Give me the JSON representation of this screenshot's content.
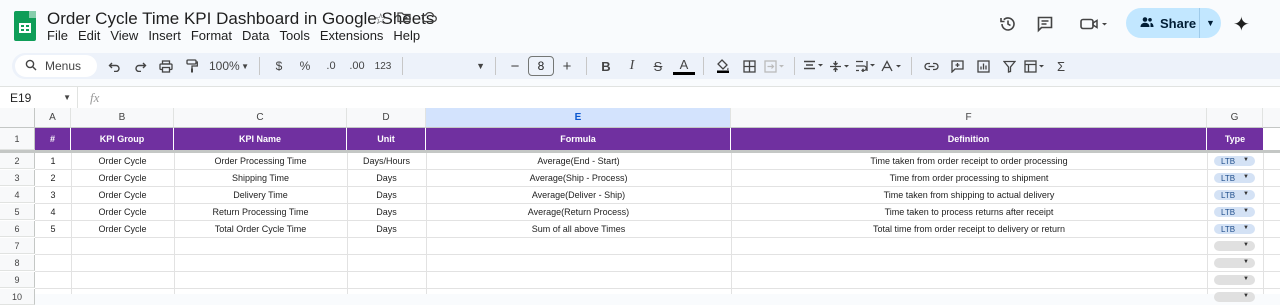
{
  "app": {
    "doc_title": "Order Cycle Time KPI Dashboard in Google Sheets",
    "menu": [
      "File",
      "Edit",
      "View",
      "Insert",
      "Format",
      "Data",
      "Tools",
      "Extensions",
      "Help"
    ],
    "share_label": "Share"
  },
  "toolbar": {
    "menus_label": "Menus",
    "zoom": "100%",
    "currency": "$",
    "percent": "%",
    "dec_decrease": ".0",
    "dec_increase": ".00",
    "number_format": "123",
    "font_size": "8",
    "bold": "B",
    "italic": "I",
    "strike": "S",
    "text_color": "A",
    "sigma": "Σ"
  },
  "formula_bar": {
    "cell_ref": "E19",
    "fx": "fx",
    "value": ""
  },
  "sheet": {
    "columns": [
      "A",
      "B",
      "C",
      "D",
      "E",
      "F",
      "G"
    ],
    "selected_column": "E",
    "header_row": {
      "row_number": "1",
      "cells": [
        "#",
        "KPI Group",
        "KPI Name",
        "Unit",
        "Formula",
        "Definition",
        "Type"
      ]
    },
    "rows": [
      {
        "n": "2",
        "cells": [
          "1",
          "Order Cycle",
          "Order Processing Time",
          "Days/Hours",
          "Average(End - Start)",
          "Time taken from order receipt to order processing",
          "LTB"
        ]
      },
      {
        "n": "3",
        "cells": [
          "2",
          "Order Cycle",
          "Shipping Time",
          "Days",
          "Average(Ship - Process)",
          "Time from order processing to shipment",
          "LTB"
        ]
      },
      {
        "n": "4",
        "cells": [
          "3",
          "Order Cycle",
          "Delivery Time",
          "Days",
          "Average(Deliver - Ship)",
          "Time taken from shipping to actual delivery",
          "LTB"
        ]
      },
      {
        "n": "5",
        "cells": [
          "4",
          "Order Cycle",
          "Return Processing Time",
          "Days",
          "Average(Return Process)",
          "Time taken to process returns after receipt",
          "LTB"
        ]
      },
      {
        "n": "6",
        "cells": [
          "5",
          "Order Cycle",
          "Total Order Cycle Time",
          "Days",
          "Sum of all above Times",
          "Total time from order receipt to delivery or return",
          "LTB"
        ]
      }
    ],
    "empty_rows": [
      "7",
      "8",
      "9",
      "10"
    ]
  },
  "colors": {
    "header_fill": "#7030a0",
    "chip_fill": "#d4e2f5",
    "share_fill": "#c2e7ff",
    "logo_green": "#0f9d58"
  }
}
